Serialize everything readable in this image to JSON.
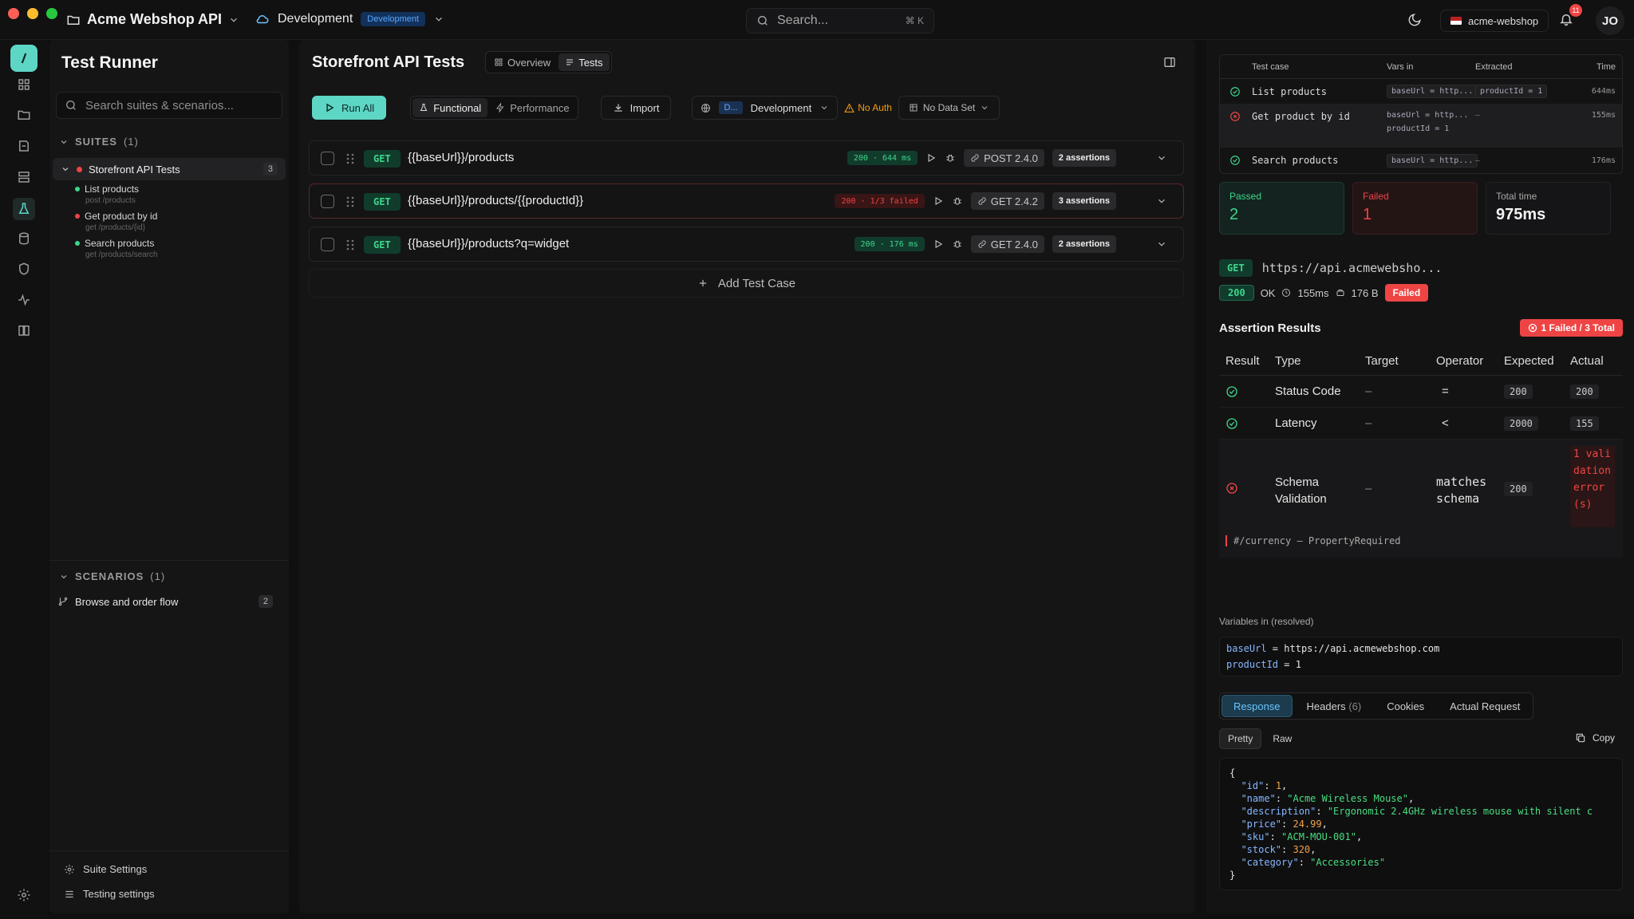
{
  "header": {
    "app_title": "Acme Webshop API",
    "env_name": "Development",
    "env_badge": "Development",
    "search_placeholder": "Search...",
    "search_shortcut": "⌘ K",
    "workspace": "acme-webshop",
    "notif_count": "11",
    "avatar_initials": "JO"
  },
  "sidebar": {
    "title": "Test Runner",
    "search_placeholder": "Search suites & scenarios...",
    "suites_label": "SUITES",
    "suites_count": "(1)",
    "suite": {
      "name": "Storefront API Tests",
      "count": "3"
    },
    "scenarios_list": [
      {
        "name": "List products",
        "path": "post /products",
        "status_color": "#3dd68c"
      },
      {
        "name": "Get product by id",
        "path": "get /products/{id}",
        "status_color": "#ef4444"
      },
      {
        "name": "Search products",
        "path": "get /products/search",
        "status_color": "#3dd68c"
      }
    ],
    "scenarios_label": "SCENARIOS",
    "scenarios_count": "(1)",
    "scenario_flow": {
      "name": "Browse and order flow",
      "count": "2"
    },
    "footer": {
      "suite_settings": "Suite Settings",
      "testing_settings": "Testing settings"
    }
  },
  "main": {
    "title": "Storefront API Tests",
    "tabs": {
      "overview": "Overview",
      "tests": "Tests"
    },
    "toolbar": {
      "run_all": "Run All",
      "functional": "Functional",
      "performance": "Performance",
      "import": "Import",
      "env_short": "D...",
      "env": "Development",
      "auth": "No Auth",
      "dataset": "No Data Set"
    },
    "test_cases": [
      {
        "method": "GET",
        "url": "{{baseUrl}}/products",
        "status": "200 · 644 ms",
        "link": "POST 2.4.0",
        "assertions": "2 assertions",
        "failed": false
      },
      {
        "method": "GET",
        "url": "{{baseUrl}}/products/{{productId}}",
        "status": "200 · 1/3 failed",
        "link": "GET 2.4.2",
        "assertions": "3 assertions",
        "failed": true
      },
      {
        "method": "GET",
        "url": "{{baseUrl}}/products?q=widget",
        "status": "200 · 176 ms",
        "link": "GET 2.4.0",
        "assertions": "2 assertions",
        "failed": false
      }
    ],
    "add_test_case": "Add Test Case"
  },
  "results": {
    "headers": {
      "test_case": "Test case",
      "vars_in": "Vars in",
      "extracted": "Extracted",
      "time": "Time"
    },
    "rows": [
      {
        "name": "List products",
        "vars": "baseUrl = http...",
        "vars2": "",
        "extracted": "productId = 1",
        "time": "644ms"
      },
      {
        "name": "Get product by id",
        "vars": "baseUrl = http...",
        "vars2": "productId = 1",
        "extracted": "—",
        "time": "155ms"
      },
      {
        "name": "Search products",
        "vars": "baseUrl = http...",
        "vars2": "",
        "extracted": "—",
        "time": "176ms"
      }
    ],
    "passed_label": "Passed",
    "passed_value": "2",
    "failed_label": "Failed",
    "failed_value": "1",
    "total_label": "Total time",
    "total_value": "975ms",
    "req_method": "GET",
    "req_url": "https://api.acmewebsho...",
    "status_code": "200",
    "status_text": "OK",
    "latency": "155ms",
    "size": "176 B",
    "result_badge": "Failed",
    "assertion_title": "Assertion Results",
    "assertion_summary": "1 Failed / 3 Total",
    "assertion_headers": {
      "result": "Result",
      "type": "Type",
      "target": "Target",
      "operator": "Operator",
      "expected": "Expected",
      "actual": "Actual"
    },
    "assertions": [
      {
        "type": "Status Code",
        "target": "–",
        "operator": "=",
        "expected": "200",
        "actual": "200"
      },
      {
        "type": "Latency",
        "target": "–",
        "operator": "<",
        "expected": "2000",
        "actual": "155"
      },
      {
        "type": "Schema Validation",
        "target": "–",
        "operator": "matches schema",
        "expected": "200",
        "actual": "1 validation error(s)"
      }
    ],
    "schema_error": "#/currency — PropertyRequired",
    "vars_title": "Variables in (resolved)",
    "vars_lines": {
      "base_key": "baseUrl",
      "base_val": "https://api.acmewebshop.com",
      "pid_key": "productId",
      "pid_val": "1"
    },
    "resp_tabs": {
      "response": "Response",
      "headers": "Headers",
      "headers_count": "(6)",
      "cookies": "Cookies",
      "actual_request": "Actual Request"
    },
    "pretty": "Pretty",
    "raw": "Raw",
    "copy": "Copy",
    "json": {
      "id": "1",
      "name": "\"Acme Wireless Mouse\"",
      "description": "\"Ergonomic 2.4GHz wireless mouse with silent c",
      "price": "24.99",
      "sku": "\"ACM-MOU-001\"",
      "stock": "320",
      "category": "\"Accessories\""
    }
  },
  "colors": {
    "accent": "#5ed6c6",
    "pass": "#3dd68c",
    "fail": "#ef4444",
    "warn": "#f59e0b"
  }
}
